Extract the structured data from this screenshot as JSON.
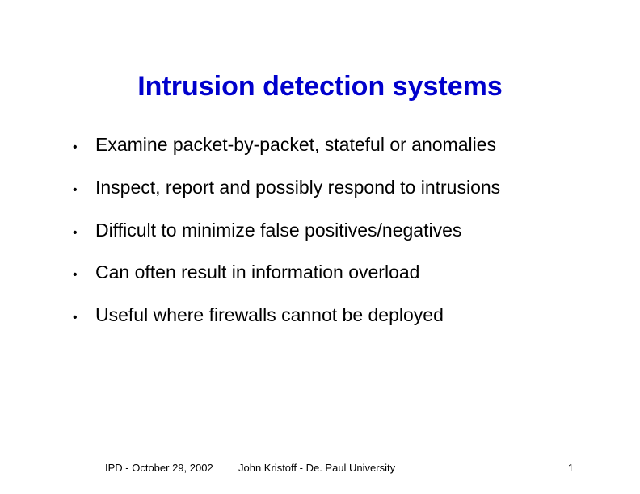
{
  "title": "Intrusion detection systems",
  "bullets": [
    "Examine packet-by-packet, stateful or anomalies",
    "Inspect, report and possibly respond to intrusions",
    "Difficult to minimize false positives/negatives",
    "Can often result in information overload",
    "Useful where firewalls cannot be deployed"
  ],
  "footer": {
    "left": "IPD - October 29, 2002",
    "center": "John Kristoff - De. Paul University",
    "page": "1"
  }
}
